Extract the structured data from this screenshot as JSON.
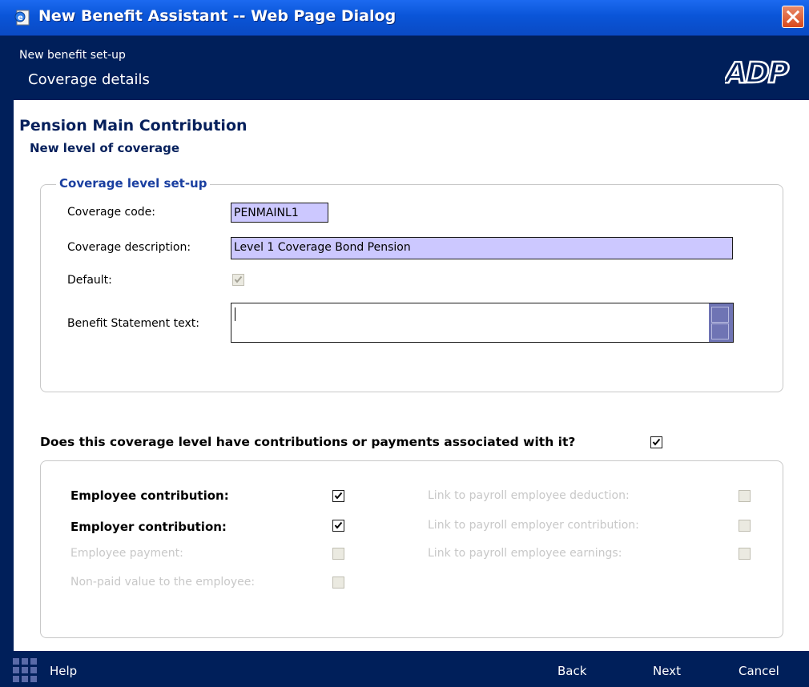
{
  "window": {
    "title": "New Benefit Assistant -- Web Page Dialog"
  },
  "header": {
    "subtitle": "New benefit set-up",
    "title": "Coverage details",
    "logo_text": "ADP"
  },
  "section": {
    "title": "Pension Main Contribution",
    "subtitle": "New level of coverage"
  },
  "coverage_setup": {
    "legend": "Coverage level set-up",
    "code_label": "Coverage code:",
    "code_value": "PENMAINL1",
    "description_label": "Coverage description:",
    "description_value": "Level 1 Coverage Bond Pension",
    "default_label": "Default:",
    "default_checked": true,
    "statement_label": "Benefit Statement text:",
    "statement_value": ""
  },
  "contributions": {
    "question": "Does this coverage level have contributions or payments associated with it?",
    "question_checked": true,
    "left": [
      {
        "label": "Employee contribution:",
        "checked": true,
        "enabled": true
      },
      {
        "label": "Employer contribution:",
        "checked": true,
        "enabled": true
      },
      {
        "label": "Employee payment:",
        "checked": false,
        "enabled": false
      },
      {
        "label": "Non-paid value to the employee:",
        "checked": false,
        "enabled": false
      }
    ],
    "right": [
      {
        "label": "Link to payroll employee deduction:",
        "checked": false,
        "enabled": false
      },
      {
        "label": "Link to payroll employer contribution:",
        "checked": false,
        "enabled": false
      },
      {
        "label": "Link to payroll employee earnings:",
        "checked": false,
        "enabled": false
      }
    ]
  },
  "footer": {
    "help": "Help",
    "back": "Back",
    "next": "Next",
    "cancel": "Cancel"
  },
  "colors": {
    "header_bg": "#001f5a",
    "field_bg": "#ccc8ff",
    "titlebar": "#0a55d8",
    "heading": "#06205c"
  }
}
